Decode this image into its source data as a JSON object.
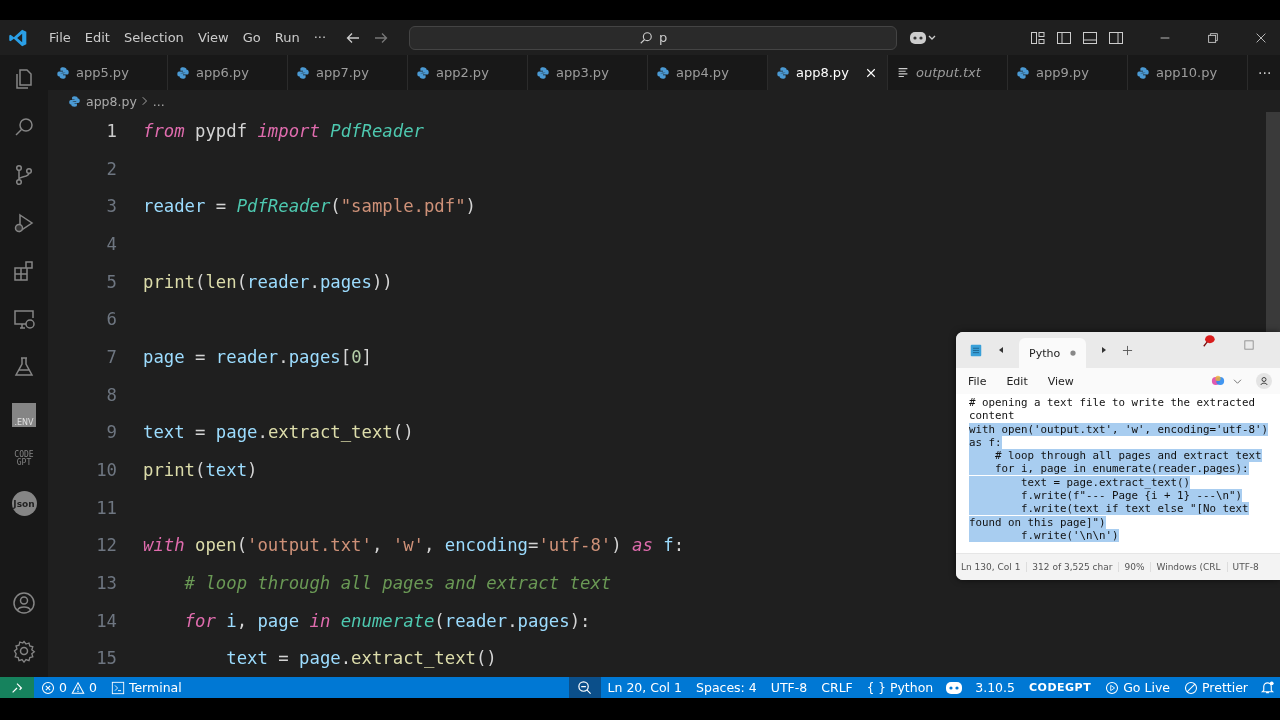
{
  "menu": [
    "File",
    "Edit",
    "Selection",
    "View",
    "Go",
    "Run",
    "···"
  ],
  "search": {
    "value": "p"
  },
  "activity_bar": [
    {
      "kind": "files"
    },
    {
      "kind": "search"
    },
    {
      "kind": "source-control"
    },
    {
      "kind": "run"
    },
    {
      "kind": "extensions"
    },
    {
      "kind": "remote"
    },
    {
      "kind": "testing"
    },
    {
      "kind": "env",
      "label": ".ENV"
    },
    {
      "kind": "codegpt",
      "label": "CODE GPT"
    },
    {
      "kind": "json",
      "label": "Json"
    }
  ],
  "tabs": [
    {
      "label": "app5.py",
      "kind": "python",
      "selected": false
    },
    {
      "label": "app6.py",
      "kind": "python",
      "selected": false
    },
    {
      "label": "app7.py",
      "kind": "python",
      "selected": false
    },
    {
      "label": "app2.py",
      "kind": "python",
      "selected": false
    },
    {
      "label": "app3.py",
      "kind": "python",
      "selected": false
    },
    {
      "label": "app4.py",
      "kind": "python",
      "selected": false
    },
    {
      "label": "app8.py",
      "kind": "python",
      "selected": true
    },
    {
      "label": "output.txt",
      "kind": "text",
      "selected": false
    },
    {
      "label": "app9.py",
      "kind": "python",
      "selected": false
    },
    {
      "label": "app10.py",
      "kind": "python",
      "selected": false
    }
  ],
  "more_tabs": "···",
  "breadcrumb": {
    "file": "app8.py",
    "rest": "..."
  },
  "code_lines": [
    {
      "number": "1",
      "tokens": [
        {
          "kind": "keyword",
          "text": "from"
        },
        {
          "kind": "plain",
          "text": " pypdf "
        },
        {
          "kind": "keyword",
          "text": "import "
        },
        {
          "kind": "class",
          "text": "PdfReader"
        }
      ]
    },
    {
      "number": "2"
    },
    {
      "number": "3",
      "tokens": [
        {
          "kind": "variable",
          "text": "reader"
        },
        {
          "kind": "plain",
          "text": " = "
        },
        {
          "kind": "class",
          "text": "PdfReader"
        },
        {
          "kind": "plain",
          "text": "("
        },
        {
          "kind": "string",
          "text": "\"sample.pdf\""
        },
        {
          "kind": "plain",
          "text": ")"
        }
      ]
    },
    {
      "number": "4"
    },
    {
      "number": "5",
      "tokens": [
        {
          "kind": "function",
          "text": "print"
        },
        {
          "kind": "plain",
          "text": "("
        },
        {
          "kind": "function",
          "text": "len"
        },
        {
          "kind": "plain",
          "text": "("
        },
        {
          "kind": "variable",
          "text": "reader"
        },
        {
          "kind": "plain",
          "text": "."
        },
        {
          "kind": "variable",
          "text": "pages"
        },
        {
          "kind": "plain",
          "text": "))"
        }
      ]
    },
    {
      "number": "6"
    },
    {
      "number": "7",
      "tokens": [
        {
          "kind": "variable",
          "text": "page"
        },
        {
          "kind": "plain",
          "text": " = "
        },
        {
          "kind": "variable",
          "text": "reader"
        },
        {
          "kind": "plain",
          "text": "."
        },
        {
          "kind": "variable",
          "text": "pages"
        },
        {
          "kind": "plain",
          "text": "["
        },
        {
          "kind": "number",
          "text": "0"
        },
        {
          "kind": "plain",
          "text": "]"
        }
      ]
    },
    {
      "number": "8"
    },
    {
      "number": "9",
      "tokens": [
        {
          "kind": "variable",
          "text": "text"
        },
        {
          "kind": "plain",
          "text": " = "
        },
        {
          "kind": "variable",
          "text": "page"
        },
        {
          "kind": "plain",
          "text": "."
        },
        {
          "kind": "function",
          "text": "extract_text"
        },
        {
          "kind": "plain",
          "text": "()"
        }
      ]
    },
    {
      "number": "10",
      "tokens": [
        {
          "kind": "function",
          "text": "print"
        },
        {
          "kind": "plain",
          "text": "("
        },
        {
          "kind": "variable",
          "text": "text"
        },
        {
          "kind": "plain",
          "text": ")"
        }
      ]
    },
    {
      "number": "11"
    },
    {
      "number": "12",
      "tokens": [
        {
          "kind": "keyword",
          "text": "with "
        },
        {
          "kind": "function",
          "text": "open"
        },
        {
          "kind": "plain",
          "text": "("
        },
        {
          "kind": "string",
          "text": "'output.txt'"
        },
        {
          "kind": "plain",
          "text": ", "
        },
        {
          "kind": "string",
          "text": "'w'"
        },
        {
          "kind": "plain",
          "text": ", "
        },
        {
          "kind": "variable",
          "text": "encoding"
        },
        {
          "kind": "plain",
          "text": "="
        },
        {
          "kind": "string",
          "text": "'utf-8'"
        },
        {
          "kind": "plain",
          "text": ") "
        },
        {
          "kind": "keyword",
          "text": "as "
        },
        {
          "kind": "variable",
          "text": "f"
        },
        {
          "kind": "plain",
          "text": ":"
        }
      ]
    },
    {
      "number": "13",
      "tokens": [
        {
          "kind": "comment",
          "text": "    # loop through all pages and extract text"
        }
      ]
    },
    {
      "number": "14",
      "tokens": [
        {
          "kind": "keyword",
          "text": "    for "
        },
        {
          "kind": "variable",
          "text": "i"
        },
        {
          "kind": "plain",
          "text": ", "
        },
        {
          "kind": "variable",
          "text": "page "
        },
        {
          "kind": "keyword",
          "text": "in "
        },
        {
          "kind": "class",
          "text": "enumerate"
        },
        {
          "kind": "plain",
          "text": "("
        },
        {
          "kind": "variable",
          "text": "reader"
        },
        {
          "kind": "plain",
          "text": "."
        },
        {
          "kind": "variable",
          "text": "pages"
        },
        {
          "kind": "plain",
          "text": "):"
        }
      ]
    },
    {
      "number": "15",
      "tokens": [
        {
          "kind": "variable",
          "text": "        text"
        },
        {
          "kind": "plain",
          "text": " = "
        },
        {
          "kind": "variable",
          "text": "page"
        },
        {
          "kind": "plain",
          "text": "."
        },
        {
          "kind": "function",
          "text": "extract_text"
        },
        {
          "kind": "plain",
          "text": "()"
        }
      ]
    }
  ],
  "notepad": {
    "tab": "Pytho",
    "unsaved": true,
    "menu": [
      "File",
      "Edit",
      "View"
    ],
    "lines": [
      {
        "text": "# opening a text file to write the extracted",
        "selected": false
      },
      {
        "text": "content",
        "selected": false
      },
      {
        "text": "with open('output.txt', 'w', encoding='utf-8')",
        "selected": true
      },
      {
        "text": "as f:",
        "selected": true
      },
      {
        "text": "    # loop through all pages and extract text",
        "selected": true
      },
      {
        "text": "    for i, page in enumerate(reader.pages):",
        "selected": true
      },
      {
        "text": "        text = page.extract_text()",
        "selected": true
      },
      {
        "text": "        f.write(f\"--- Page {i + 1} ---\\n\")",
        "selected": true
      },
      {
        "text": "        f.write(text if text else \"[No text",
        "selected": true
      },
      {
        "text": "found on this page]\")",
        "selected": true
      },
      {
        "text": "        f.write('\\n\\n')",
        "selected": true
      }
    ],
    "status": [
      "Ln 130, Col 1",
      "312 of 3,525 char",
      "90%",
      "Windows (CRL",
      "UTF-8"
    ]
  },
  "status_bar": {
    "errors": "0",
    "warnings": "0",
    "terminal": "Terminal",
    "position": "Ln 20, Col 1",
    "spaces": "Spaces: 4",
    "encoding": "UTF-8",
    "eol": "CRLF",
    "language_braces": "{ }",
    "language": "Python",
    "python_version": "3.10.5",
    "codegpt": "CODEGPT",
    "go_live": "Go Live",
    "prettier": "Prettier"
  }
}
